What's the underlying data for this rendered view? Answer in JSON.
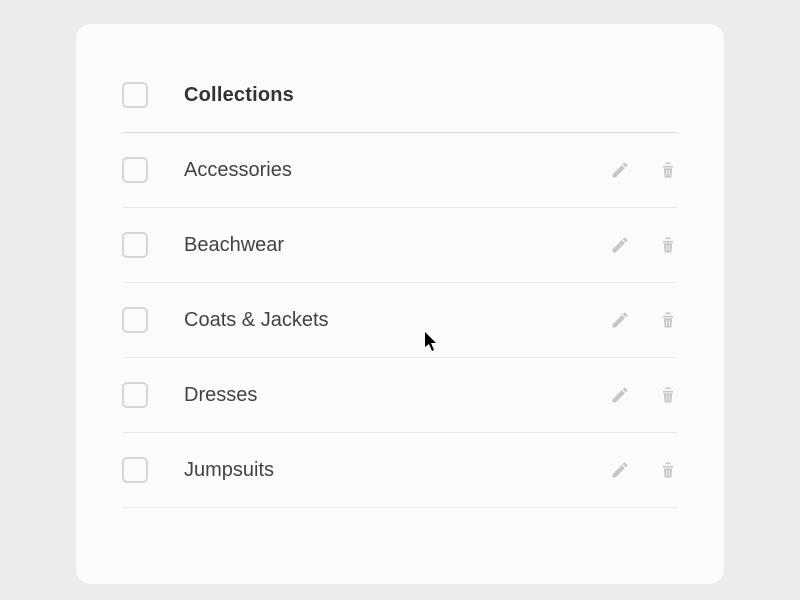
{
  "header": {
    "title": "Collections"
  },
  "rows": [
    {
      "label": "Accessories"
    },
    {
      "label": "Beachwear"
    },
    {
      "label": "Coats & Jackets"
    },
    {
      "label": "Dresses"
    },
    {
      "label": "Jumpsuits"
    }
  ]
}
